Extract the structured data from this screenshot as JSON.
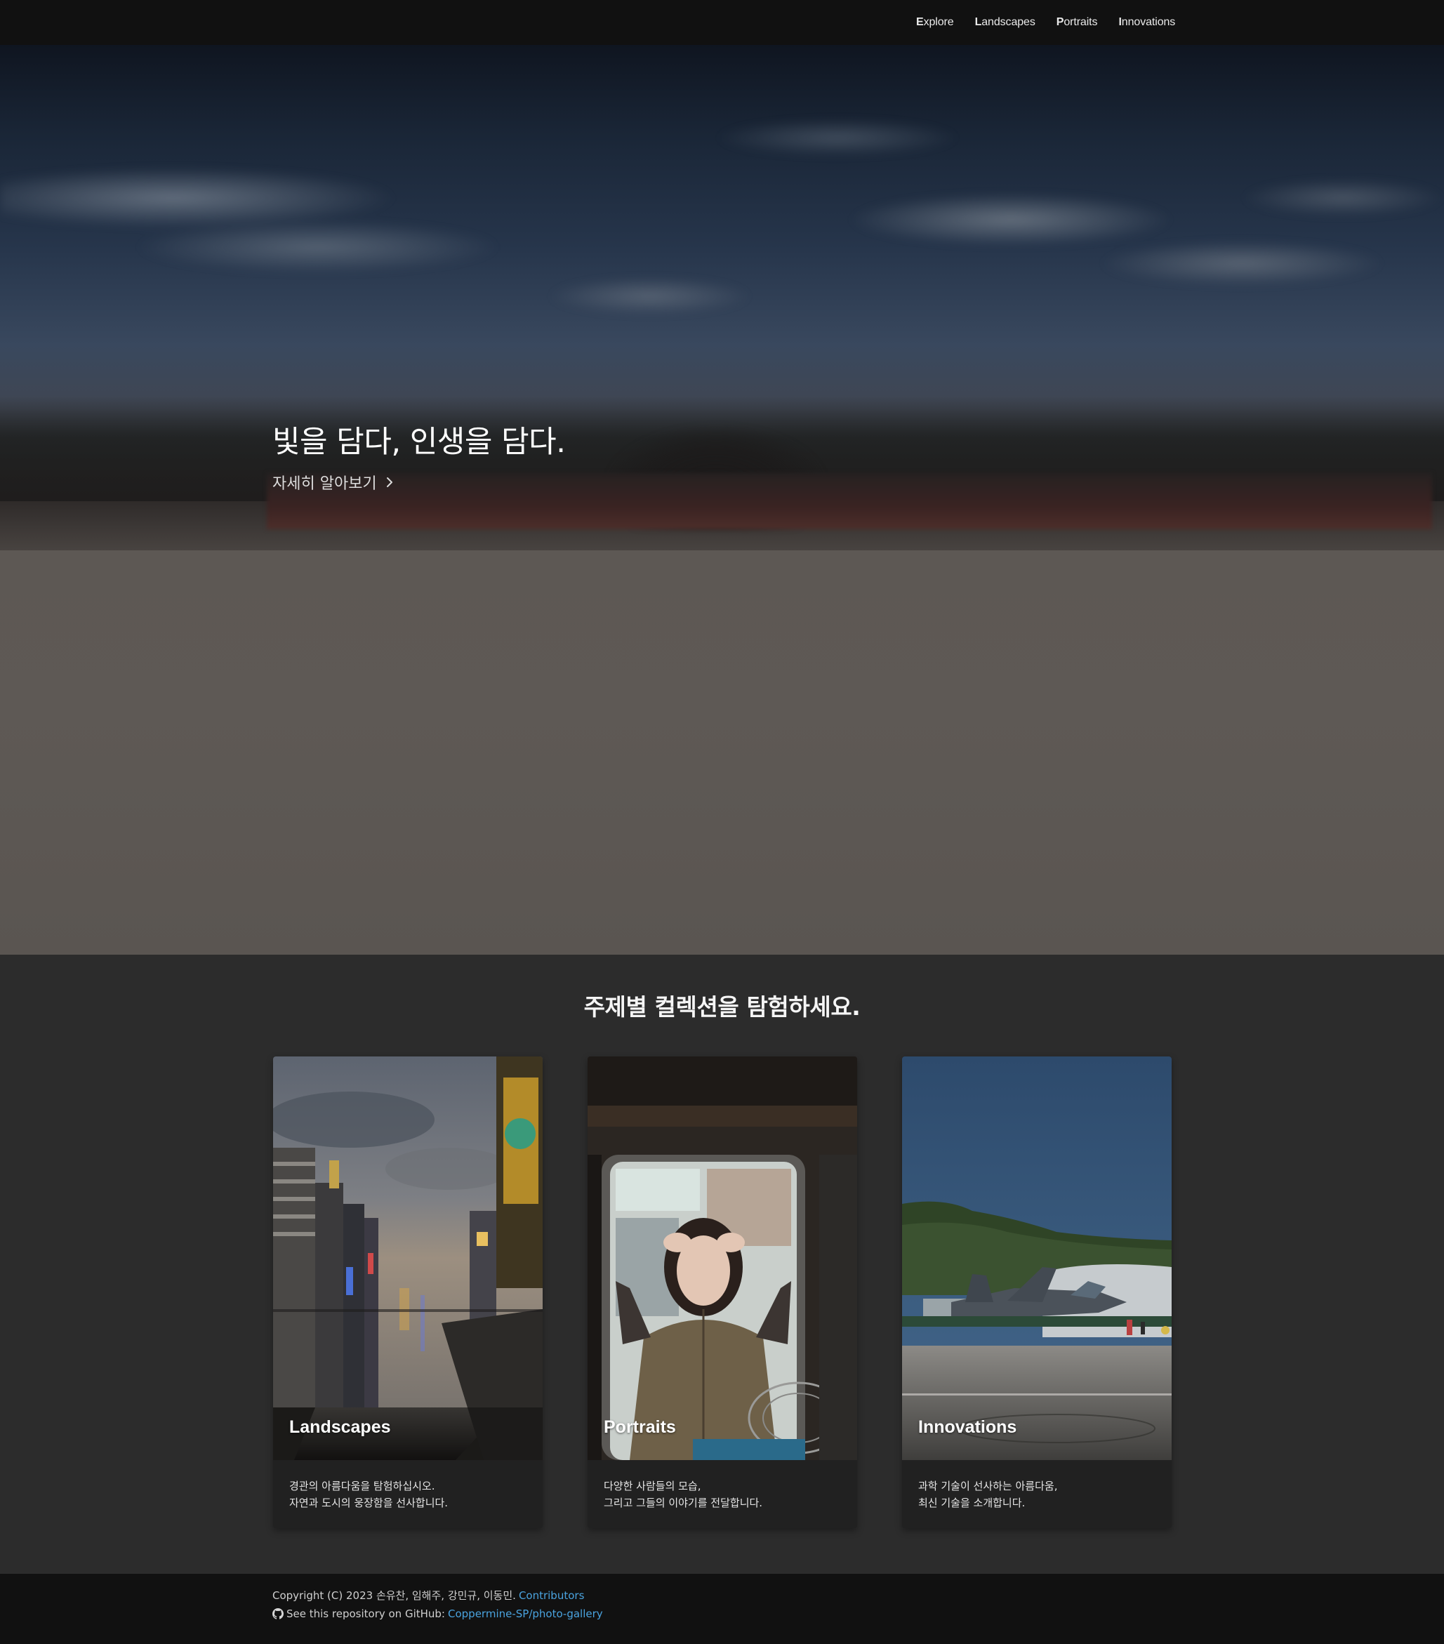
{
  "nav": {
    "items": [
      {
        "label": "Explore"
      },
      {
        "label": "Landscapes"
      },
      {
        "label": "Portraits"
      },
      {
        "label": "Innovations"
      }
    ]
  },
  "hero": {
    "headline": "빛을 담다, 인생을 담다.",
    "link_label": "자세히 알아보기",
    "link_icon": "chevron-right-icon"
  },
  "collections": {
    "title": "주제별 컬렉션을 탐험하세요.",
    "cards": [
      {
        "title": "Landscapes",
        "desc_line1": "경관의 아름다움을 탐험하십시오.",
        "desc_line2": "자연과 도시의 웅장함을 선사합니다."
      },
      {
        "title": "Portraits",
        "desc_line1": "다양한 사람들의 모습,",
        "desc_line2": "그리고 그들의 이야기를 전달합니다."
      },
      {
        "title": "Innovations",
        "desc_line1": "과학 기술이 선사하는 아름다움,",
        "desc_line2": "최신 기술을 소개합니다."
      }
    ]
  },
  "footer": {
    "copyright_text": "Copyright (C) 2023 손유찬, 임해주, 강민규, 이동민.",
    "contributors_link": "Contributors",
    "repo_text": "See this repository on GitHub:",
    "repo_link": "Coppermine-SP/photo-gallery",
    "repo_icon": "github-icon"
  },
  "colors": {
    "nav_bg": "#111111",
    "section_bg": "#2c2c2c",
    "card_bg": "#212121",
    "link": "#4aa3df"
  }
}
